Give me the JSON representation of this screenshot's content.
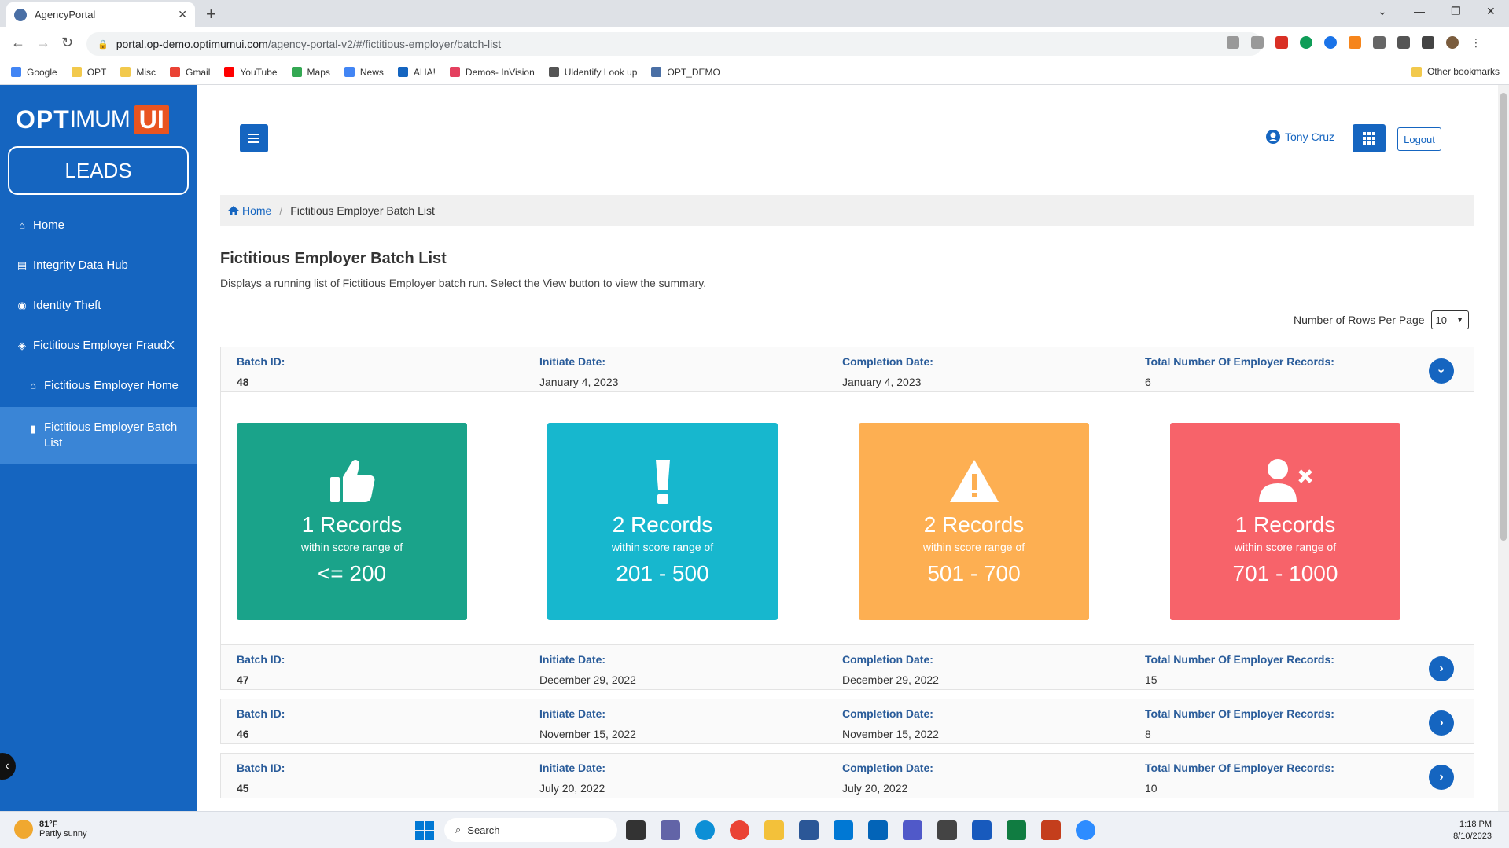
{
  "browser": {
    "tab_title": "AgencyPortal",
    "url_host": "portal.op-demo.optimumui.com",
    "url_path": "/agency-portal-v2/#/fictitious-employer/batch-list",
    "bookmarks": [
      {
        "label": "Google",
        "color": "#4285f4"
      },
      {
        "label": "OPT",
        "color": "#f2c94c"
      },
      {
        "label": "Misc",
        "color": "#f2c94c"
      },
      {
        "label": "Gmail",
        "color": "#ea4335"
      },
      {
        "label": "YouTube",
        "color": "#ff0000"
      },
      {
        "label": "Maps",
        "color": "#34a853"
      },
      {
        "label": "News",
        "color": "#4285f4"
      },
      {
        "label": "AHA!",
        "color": "#1565c0"
      },
      {
        "label": "Demos- InVision",
        "color": "#e4405f"
      },
      {
        "label": "Uldentify Look up",
        "color": "#555555"
      },
      {
        "label": "OPT_DEMO",
        "color": "#4a6fa5"
      }
    ],
    "other_bookmarks": "Other bookmarks"
  },
  "sidebar": {
    "logo": {
      "part1": "OPT",
      "part2": "IMUM",
      "part3": "UI"
    },
    "module": "LEADS",
    "items": [
      {
        "label": "Home",
        "icon": "home-icon"
      },
      {
        "label": "Integrity Data Hub",
        "icon": "database-icon"
      },
      {
        "label": "Identity Theft",
        "icon": "eye-icon"
      },
      {
        "label": "Fictitious Employer FraudX",
        "icon": "tags-icon"
      },
      {
        "label": "Fictitious Employer Home",
        "icon": "home-icon"
      },
      {
        "label": "Fictitious Employer Batch List",
        "icon": "clipboard-icon"
      }
    ]
  },
  "header": {
    "user_name": "Tony Cruz",
    "logout_label": "Logout"
  },
  "breadcrumb": {
    "home": "Home",
    "current": "Fictitious Employer Batch List"
  },
  "page": {
    "title": "Fictitious Employer Batch List",
    "description": "Displays a running list of Fictitious Employer batch run. Select the View button to view the summary.",
    "rows_per_page_label": "Number of Rows Per Page",
    "rows_per_page_value": "10"
  },
  "batch_labels": {
    "batch_id": "Batch ID:",
    "initiate_date": "Initiate Date:",
    "completion_date": "Completion Date:",
    "total_records": "Total Number Of Employer Records:"
  },
  "batches": [
    {
      "id": "48",
      "initiate": "January 4, 2023",
      "completion": "January 4, 2023",
      "total": "6"
    },
    {
      "id": "47",
      "initiate": "December 29, 2022",
      "completion": "December 29, 2022",
      "total": "15"
    },
    {
      "id": "46",
      "initiate": "November 15, 2022",
      "completion": "November 15, 2022",
      "total": "8"
    },
    {
      "id": "45",
      "initiate": "July 20, 2022",
      "completion": "July 20, 2022",
      "total": "10"
    }
  ],
  "summary_tiles": [
    {
      "count": "1 Records",
      "range_label": "within score range of",
      "range": "<= 200",
      "color": "#1aa38a",
      "icon": "thumbs-up-icon"
    },
    {
      "count": "2 Records",
      "range_label": "within score range of",
      "range": "201 - 500",
      "color": "#17b7ce",
      "icon": "exclamation-icon"
    },
    {
      "count": "2 Records",
      "range_label": "within score range of",
      "range": "501 - 700",
      "color": "#fdaf52",
      "icon": "warning-icon"
    },
    {
      "count": "1 Records",
      "range_label": "within score range of",
      "range": "701 - 1000",
      "color": "#f7636a",
      "icon": "user-times-icon"
    }
  ],
  "taskbar": {
    "temperature": "81°F",
    "weather": "Partly sunny",
    "search_placeholder": "Search",
    "time": "1:18 PM",
    "date": "8/10/2023"
  }
}
